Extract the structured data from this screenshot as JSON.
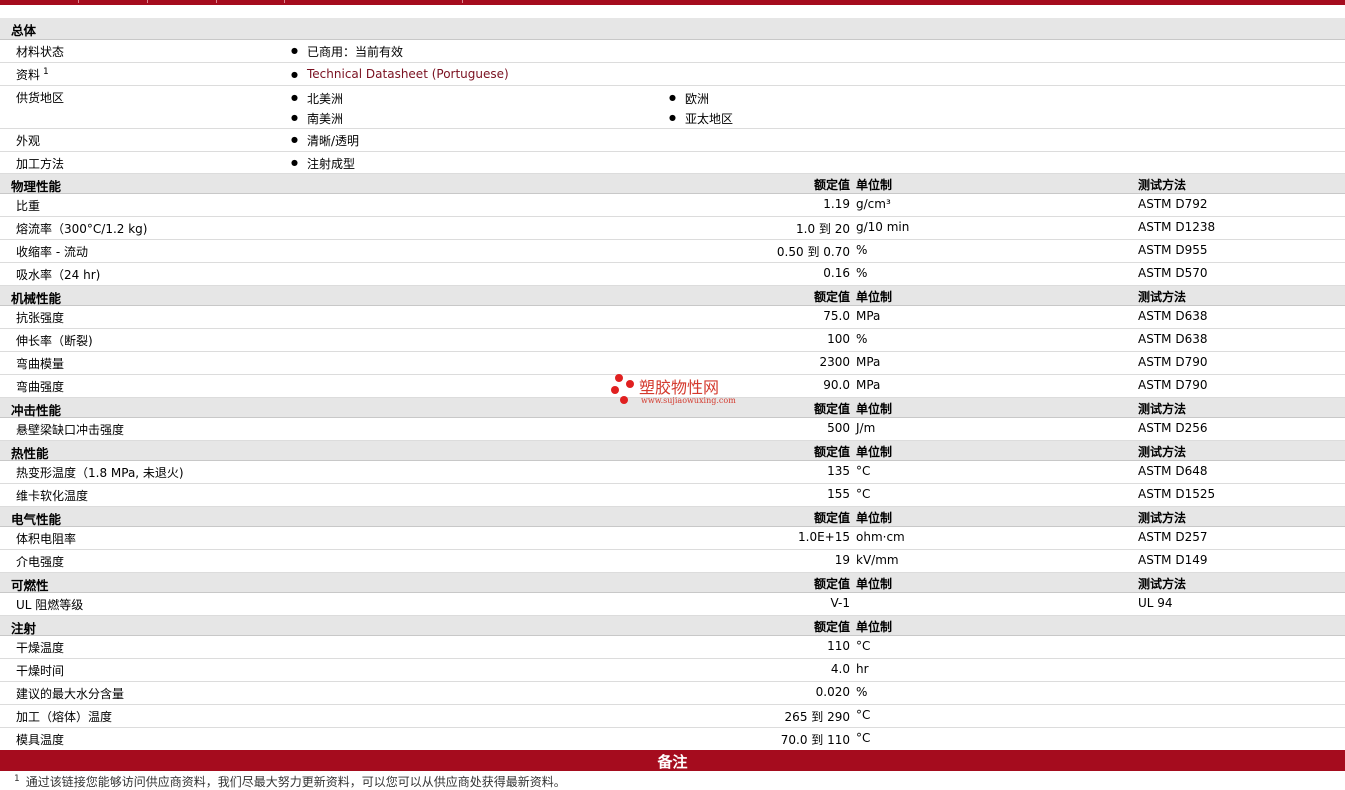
{
  "general": {
    "title": "总体",
    "rows": [
      {
        "label": "材料状态",
        "value": "已商用：当前有效"
      },
      {
        "label": "资料",
        "sup": "1",
        "value": "Technical Datasheet (Portuguese)"
      },
      {
        "label": "供货地区",
        "values": [
          "北美洲",
          "欧洲",
          "南美洲",
          "亚太地区"
        ]
      },
      {
        "label": "外观",
        "value": "清晰/透明"
      },
      {
        "label": "加工方法",
        "value": "注射成型"
      }
    ]
  },
  "headers": {
    "value": "额定值",
    "unit": "单位制",
    "test": "测试方法"
  },
  "sections": [
    {
      "title": "物理性能",
      "rows": [
        {
          "label": "比重",
          "value": "1.19",
          "unit": "g/cm³",
          "test": "ASTM D792"
        },
        {
          "label": "熔流率（300°C/1.2 kg)",
          "value": "1.0 到   20",
          "unit": "g/10 min",
          "test": "ASTM D1238"
        },
        {
          "label": "收缩率   - 流动",
          "value": "0.50 到  0.70",
          "unit": "%",
          "test": "ASTM D955"
        },
        {
          "label": "吸水率（24 hr)",
          "value": "0.16",
          "unit": "%",
          "test": "ASTM D570"
        }
      ]
    },
    {
      "title": "机械性能",
      "rows": [
        {
          "label": "抗张强度",
          "value": "75.0",
          "unit": "MPa",
          "test": "ASTM D638"
        },
        {
          "label": "伸长率（断裂)",
          "value": "100",
          "unit": "%",
          "test": "ASTM D638"
        },
        {
          "label": "弯曲模量",
          "value": "2300",
          "unit": "MPa",
          "test": "ASTM D790"
        },
        {
          "label": "弯曲强度",
          "value": "90.0",
          "unit": "MPa",
          "test": "ASTM D790"
        }
      ]
    },
    {
      "title": "冲击性能",
      "rows": [
        {
          "label": "悬壁梁缺口冲击强度",
          "value": "500",
          "unit": "J/m",
          "test": "ASTM D256"
        }
      ]
    },
    {
      "title": "热性能",
      "rows": [
        {
          "label": "热变形温度（1.8 MPa, 未退火)",
          "value": "135",
          "unit": "°C",
          "test": "ASTM D648"
        },
        {
          "label": "维卡软化温度",
          "value": "155",
          "unit": "°C",
          "test": "ASTM D1525"
        }
      ]
    },
    {
      "title": "电气性能",
      "rows": [
        {
          "label": "体积电阻率",
          "value": "1.0E+15",
          "unit": "ohm·cm",
          "test": "ASTM D257"
        },
        {
          "label": "介电强度",
          "value": "19",
          "unit": "kV/mm",
          "test": "ASTM D149"
        }
      ]
    },
    {
      "title": "可燃性",
      "rows": [
        {
          "label": "UL 阻燃等级",
          "value": "V-1",
          "unit": "",
          "test": "UL 94"
        }
      ]
    },
    {
      "title": "注射",
      "test_header": false,
      "rows": [
        {
          "label": "干燥温度",
          "value": "110",
          "unit": "°C",
          "test": ""
        },
        {
          "label": "干燥时间",
          "value": "4.0",
          "unit": "hr",
          "test": ""
        },
        {
          "label": "建议的最大水分含量",
          "value": "0.020",
          "unit": "%",
          "test": ""
        },
        {
          "label": "加工（熔体）温度",
          "value": "265 到  290",
          "unit": "°C",
          "test": ""
        },
        {
          "label": "模具温度",
          "value": "70.0 到  110",
          "unit": "°C",
          "test": ""
        }
      ]
    }
  ],
  "watermark": {
    "name": "塑胶物性网",
    "url": "www.sujiaowuxing.com"
  },
  "notes": {
    "title": "备注",
    "footnote_sup": "1",
    "footnote": "通过该链接您能够访问供应商资料，我们尽最大努力更新资料，可以您可以从供应商处获得最新资料。"
  },
  "colors": {
    "accent": "#a50c1e",
    "section_bg": "#e6e6e6",
    "link": "#7a1020"
  }
}
